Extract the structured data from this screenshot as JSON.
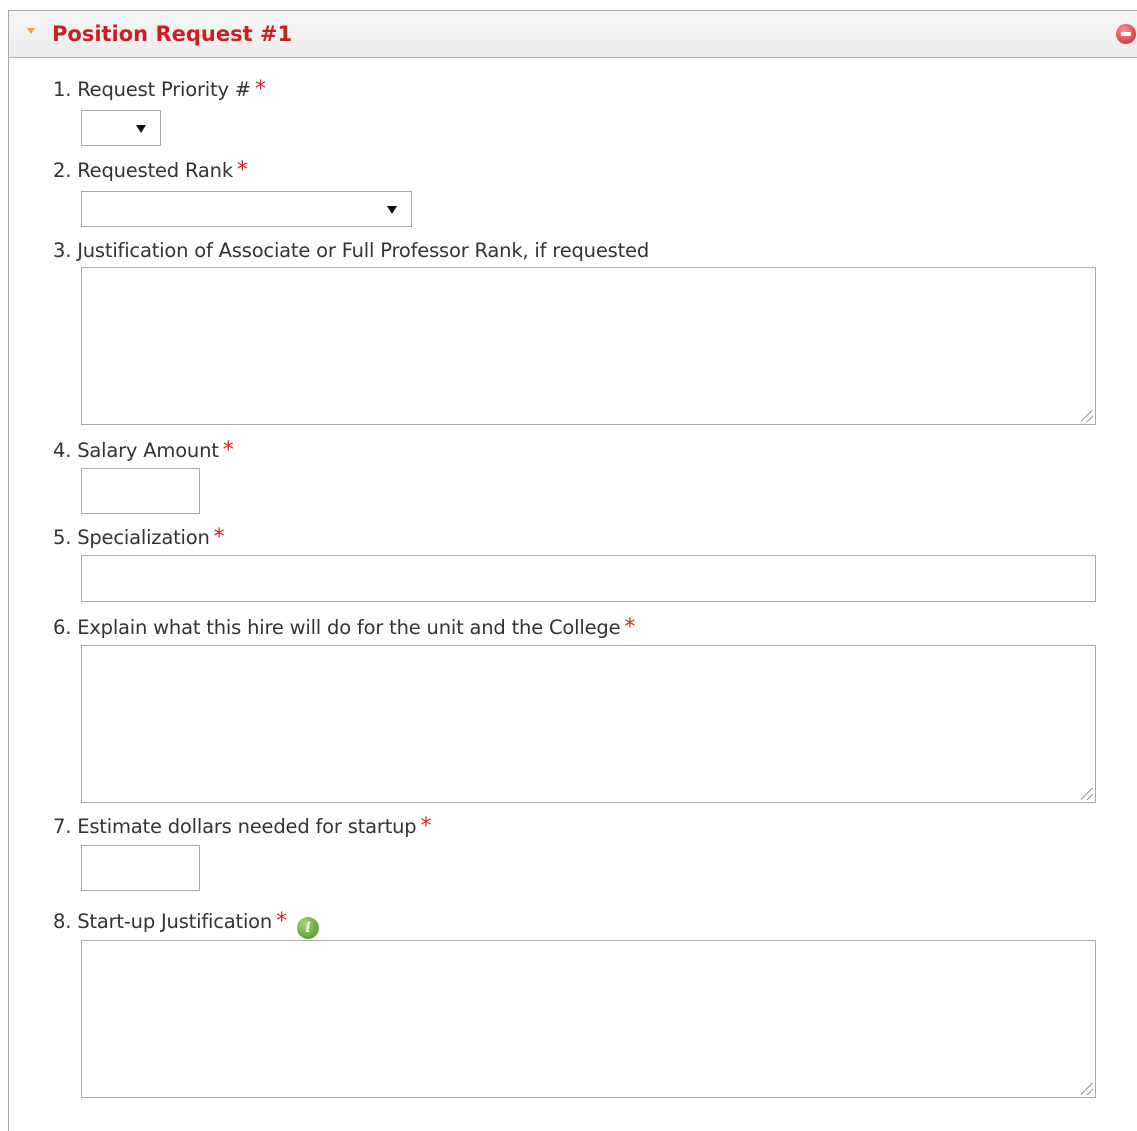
{
  "panel": {
    "title": "Position Request #1",
    "collapse_icon": "triangle-down-icon",
    "remove_icon": "remove-circle-icon"
  },
  "questions": [
    {
      "label": "1. Request Priority #",
      "required": "*",
      "field": "select",
      "value": ""
    },
    {
      "label": "2. Requested Rank",
      "required": "*",
      "field": "select",
      "value": ""
    },
    {
      "label": "3. Justification of Associate or Full Professor Rank, if requested",
      "field": "textarea",
      "value": ""
    },
    {
      "label": "4. Salary Amount",
      "required": "*",
      "field": "text",
      "value": ""
    },
    {
      "label": "5. Specialization",
      "required": "*",
      "field": "text",
      "value": ""
    },
    {
      "label": "6. Explain what this hire will do for the unit and the College",
      "required": "*",
      "field": "textarea",
      "value": ""
    },
    {
      "label": "7. Estimate dollars needed for startup",
      "required": "*",
      "field": "text",
      "value": ""
    },
    {
      "label": "8. Start-up Justification",
      "required": "*",
      "field": "textarea",
      "value": "",
      "info_icon": "i"
    }
  ],
  "colors": {
    "title": "#cc1f1f",
    "required": "#dd2222",
    "arrow": "#e8a63b",
    "remove": "#dd4a4a",
    "info": "#6aab3c"
  }
}
